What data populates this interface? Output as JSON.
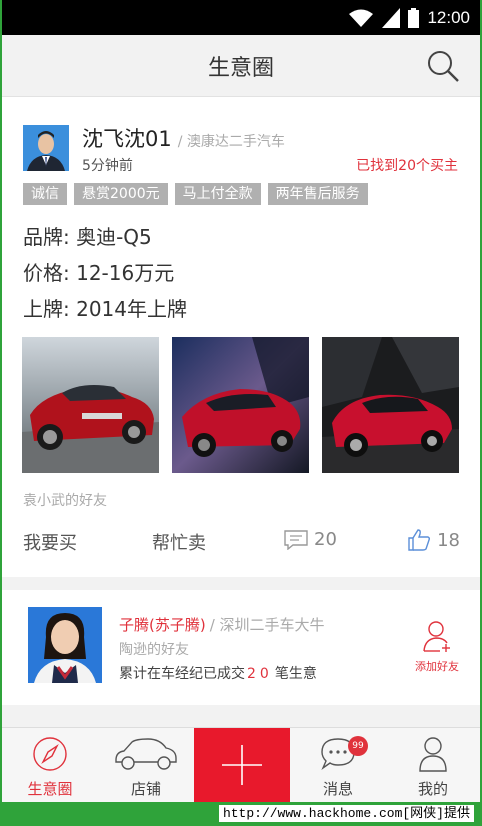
{
  "status_bar": {
    "time": "12:00"
  },
  "header": {
    "title": "生意圈"
  },
  "post": {
    "name": "沈飞沈01",
    "company": "/ 澳康达二手汽车",
    "time": "5分钟前",
    "found": "已找到20个买主",
    "tags": [
      "诚信",
      "悬赏2000元",
      "马上付全款",
      "两年售后服务"
    ],
    "brand": "品牌: 奥迪-Q5",
    "price": "价格: 12-16万元",
    "plated": "上牌: 2014年上牌",
    "friend_of": "袁小武的好友",
    "actions": {
      "buy": "我要买",
      "sell": "帮忙卖",
      "comments": "20",
      "likes": "18"
    }
  },
  "suggestion": {
    "name": "子腾(苏子腾)",
    "company": "/ 深圳二手车大牛",
    "friend_of": "陶逊的好友",
    "deals_prefix": "累计在车经纪已成交",
    "deals_count": "20",
    "deals_suffix": "笔生意",
    "add_label": "添加好友"
  },
  "tabs": [
    {
      "label": "生意圈"
    },
    {
      "label": "店铺"
    },
    {
      "label": ""
    },
    {
      "label": "消息",
      "badge": "99"
    },
    {
      "label": "我的"
    }
  ],
  "watermark": "http://www.hackhome.com[网侠]提供",
  "colors": {
    "accent": "#e0323c",
    "add_button": "#e8192c",
    "frame": "#2fa33a"
  }
}
